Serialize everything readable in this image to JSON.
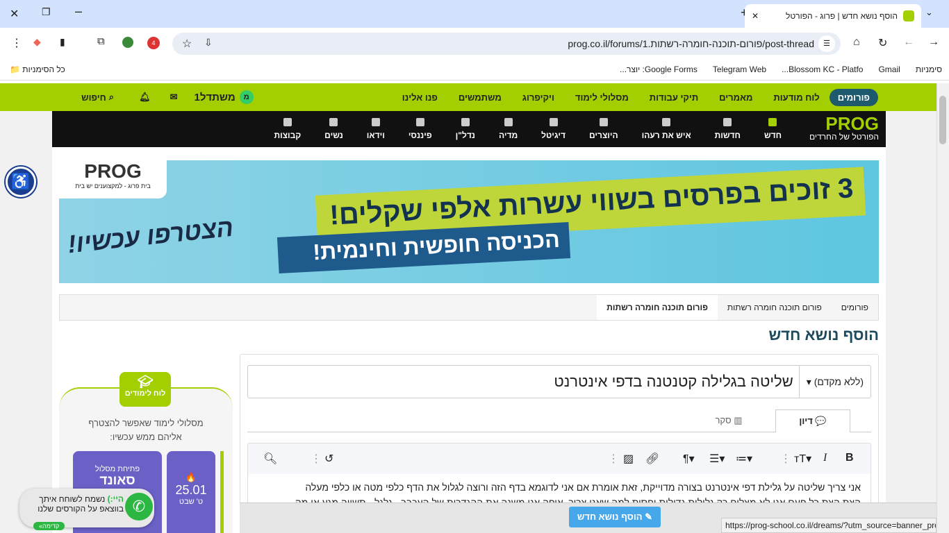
{
  "browser": {
    "tab_title": "הוסף נושא חדש | פרוג - הפורטל",
    "url": "prog.co.il/forums/פורום-תוכנה-חומרה-רשתות.1/post-thread",
    "ext_badge": "4",
    "bookmarks": [
      "סימניות",
      "Gmail",
      "Blossom KC - Platfo...",
      "Telegram Web",
      "Google Forms: יוצר..."
    ],
    "all_bookmarks": "כל הסימניות"
  },
  "topnav": {
    "forums": "פורומים",
    "items": [
      "לוח מודעות",
      "מאמרים",
      "תיקי עבודות",
      "מסלולי לימוד",
      "ויקיפרוג",
      "משתמשים",
      "פנו אלינו"
    ],
    "user": "משתדל1",
    "user_initial": "מ",
    "search": "חיפוש"
  },
  "logo": {
    "text": "PROG",
    "tagline": "הפורטל של החרדים"
  },
  "catnav": [
    "חדש",
    "חדשות",
    "איש את רעהו",
    "היוצרים",
    "דיגיטל",
    "מדיה",
    "נדל\"ן",
    "פיננסי",
    "וידאו",
    "נשים",
    "קבוצות"
  ],
  "banner": {
    "line1": "3 זוכים בפרסים בשווי עשרות אלפי שקלים!",
    "line2": "הכניסה חופשית וחינמית!",
    "cta": "הצטרפו עכשיו!",
    "brand": "PROG",
    "brand_sub": "בית פרוג - למקצוענים יש בית"
  },
  "breadcrumb": [
    "פורומים",
    "פורום תוכנה חומרה רשתות",
    "פורום תוכנה חומרה רשתות"
  ],
  "page_title": "הוסף נושא חדש",
  "form": {
    "prefix": "(ללא מקדם)",
    "title_value": "שליטה בגלילה קטנטנה בדפי אינטרנט",
    "tabs": [
      "דיון",
      "סקר"
    ],
    "body_line1": "אני צריך שליטה על גלילת דפי אינטרנט בצורה מדוייקת, זאת אומרת אם אני לדוגמא בדף הזה ורוצה לגלול את הדף כלפי מטה או כלפי מעלה",
    "body_line2": "הצת הצת כל פעם אני לא מצליח רק גלילות גדולות יחסית למה שאני צריך. איפה אני משנה את ההגדרות של העכבר - גלגל - תשווה מגע או מה",
    "submit": "הוסף נושא חדש"
  },
  "sidebar": {
    "badge": "לוח לימודים",
    "intro": "מסלולי לימוד שאפשר להצטרף אליהם ממש עכשיו:",
    "card_sub": "פתיחת מסלול",
    "card_title": "סאונד והפקות",
    "date": "25.01",
    "hebdate": "ט' שבט"
  },
  "whatsapp": {
    "hi": "היי:)",
    "msg1": "נשמח לשוחח איתך",
    "msg2": "בווצאפ על הקורסים שלנו",
    "cta": "קדימה»"
  },
  "status_url": "https://prog-school.co.il/dreams/?utm_source=banner_prog"
}
